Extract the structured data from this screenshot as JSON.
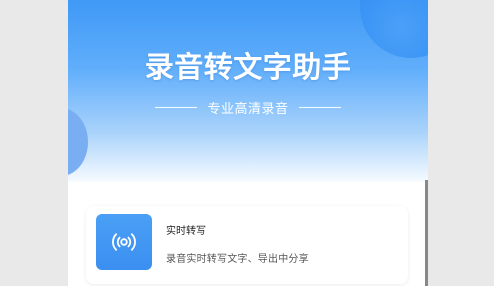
{
  "hero": {
    "title": "录音转文字助手",
    "subtitle": "专业高清录音"
  },
  "card": {
    "title": "实时转写",
    "description": "录音实时转写文字、导出中分享",
    "icon": "wireless-signal-icon"
  },
  "colors": {
    "accent": "#3f99f6",
    "card_icon_bg": "#3b8ff1"
  }
}
